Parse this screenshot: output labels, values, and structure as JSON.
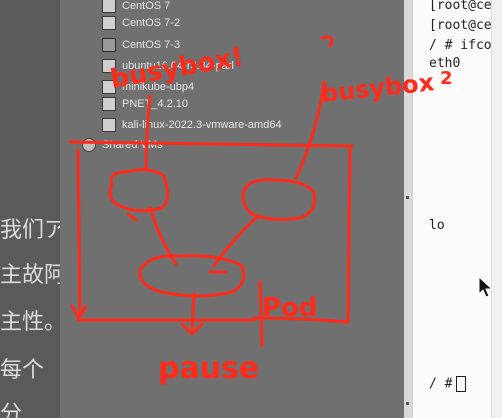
{
  "document": {
    "chars": [
      "我们ア",
      "主故阿",
      "主性。",
      "每个",
      "分"
    ]
  },
  "vm_library": {
    "items": [
      {
        "label": "CentOS 7",
        "icon": "vm-icon"
      },
      {
        "label": "CentOS 7-2",
        "icon": "vm-icon"
      },
      {
        "label": "CentOS 7-3",
        "icon": "vm-running-icon"
      },
      {
        "label": "ubuntu16.04-r3.34-parl",
        "icon": "vm-icon"
      },
      {
        "label": "minikube-ubp4",
        "icon": "vm-icon"
      },
      {
        "label": "PNET_4.2.10",
        "icon": "vm-icon"
      },
      {
        "label": "kali-linux-2022.3-vmware-amd64",
        "icon": "vm-icon"
      },
      {
        "label": "Shared VMs",
        "icon": "shared-vms-icon"
      }
    ]
  },
  "terminal": {
    "lines": [
      "[root@ce",
      "[root@ce",
      "/ # ifco",
      "eth0",
      "lo",
      "/ #"
    ]
  },
  "annotations": {
    "colors": {
      "ink": "#ff2a1a"
    },
    "texts": {
      "busybox": "busybox",
      "busybox_sup": "2",
      "busybox_left": "busybox!",
      "pod": "Pod",
      "pause": "pause"
    }
  }
}
